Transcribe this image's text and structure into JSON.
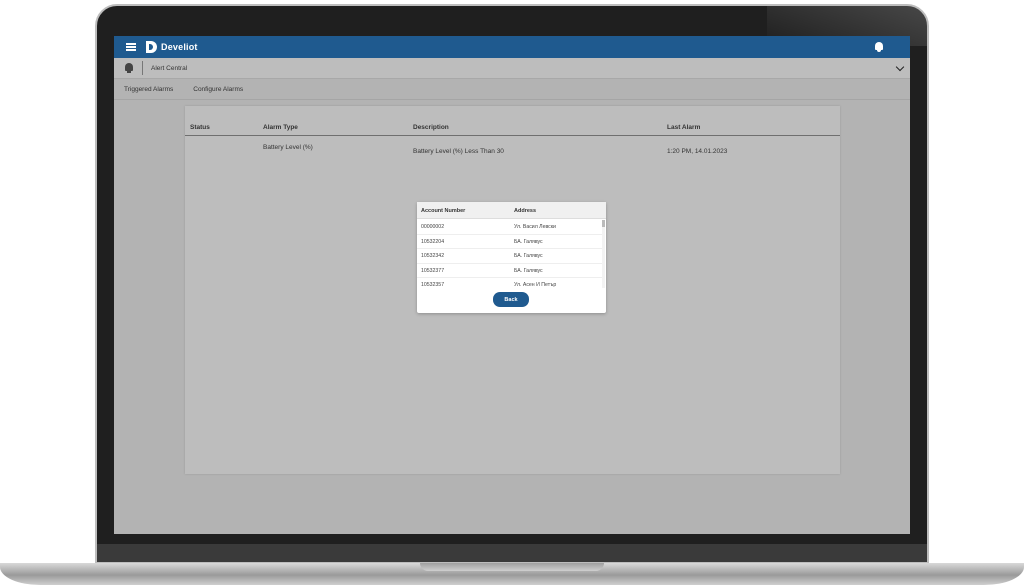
{
  "topbar": {
    "brand": "Develiot"
  },
  "subbar": {
    "section_title": "Alert Central"
  },
  "tabs": [
    {
      "label": "Triggered Alarms"
    },
    {
      "label": "Configure Alarms"
    }
  ],
  "table": {
    "headers": [
      "Status",
      "Alarm Type",
      "Description",
      "Last Alarm"
    ],
    "rows": [
      {
        "status": "",
        "alarm_type": "Battery Level (%)",
        "description": "Battery Level (%) Less Than 30",
        "last_alarm": "1:20 PM, 14.01.2023"
      }
    ]
  },
  "modal": {
    "headers": [
      "Account Number",
      "Address"
    ],
    "rows": [
      {
        "account": "00000002",
        "address": "Ул. Васил Левски"
      },
      {
        "account": "10532204",
        "address": "БА. Галявус"
      },
      {
        "account": "10532342",
        "address": "БА. Галявус"
      },
      {
        "account": "10532377",
        "address": "БА. Галявус"
      },
      {
        "account": "10532357",
        "address": "Ул. Асен И Петър"
      }
    ],
    "back_label": "Back"
  }
}
